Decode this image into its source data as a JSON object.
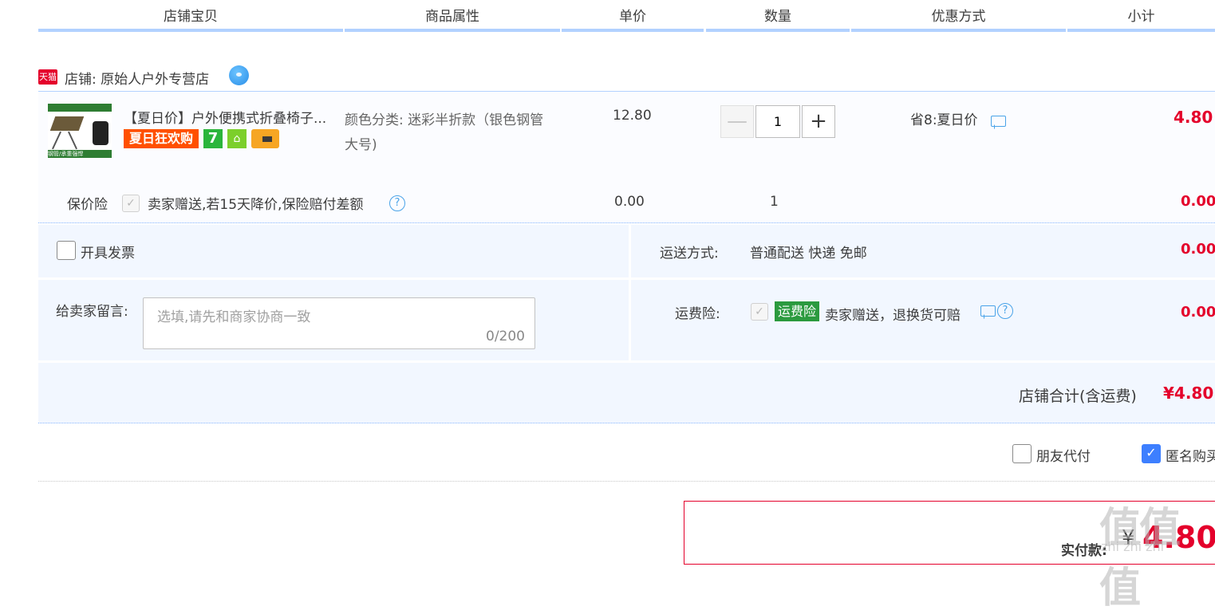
{
  "header": {
    "cols": [
      "店铺宝贝",
      "商品属性",
      "单价",
      "数量",
      "优惠方式",
      "小计"
    ]
  },
  "shop": {
    "badge": "天猫",
    "label": "店铺: 原始人户外专营店"
  },
  "item": {
    "title": "【夏日价】户外便携式折叠椅子...",
    "sale_tag": "夏日狂欢购",
    "tag_7": "7",
    "thumb_band": "钢管/承重强悍",
    "attr_line1": "颜色分类: 迷彩半折款（银色钢管",
    "attr_line2": "大号)",
    "price": "12.80",
    "quantity": "1",
    "minus": "—",
    "plus": "+",
    "discount": "省8:夏日价",
    "subtotal": "4.80"
  },
  "insurance": {
    "label": "保价险",
    "check_mark": "✓",
    "desc": "卖家赠送,若15天降价,保险赔付差额",
    "help": "?",
    "price": "0.00",
    "qty": "1",
    "subtotal": "0.00"
  },
  "invoice": {
    "label": "开具发票"
  },
  "shipping": {
    "label": "运送方式:",
    "value": "普通配送 快递 免邮",
    "amount": "0.00"
  },
  "message": {
    "label": "给卖家留言:",
    "placeholder": "选填,请先和商家协商一致",
    "counter": "0/200"
  },
  "freight_insurance": {
    "label": "运费险:",
    "check_mark": "✓",
    "tag": "运费险",
    "desc": "卖家赠送，退换货可赔",
    "help": "?",
    "amount": "0.00"
  },
  "shop_total": {
    "label": "店铺合计(含运费)",
    "amount": "¥4.80"
  },
  "options": {
    "friend_pay": "朋友代付",
    "anonymous": "匿名购买",
    "check_mark": "✓"
  },
  "payment": {
    "label": "实付款:",
    "currency": "¥",
    "amount": "4.80"
  },
  "watermark": {
    "main": "值值值",
    "sub": "zhi zhi zhi"
  },
  "colors": {
    "accent_blue": "#b2d1ff",
    "price_red": "#e4002b",
    "panel_bg": "#f2f7ff"
  }
}
